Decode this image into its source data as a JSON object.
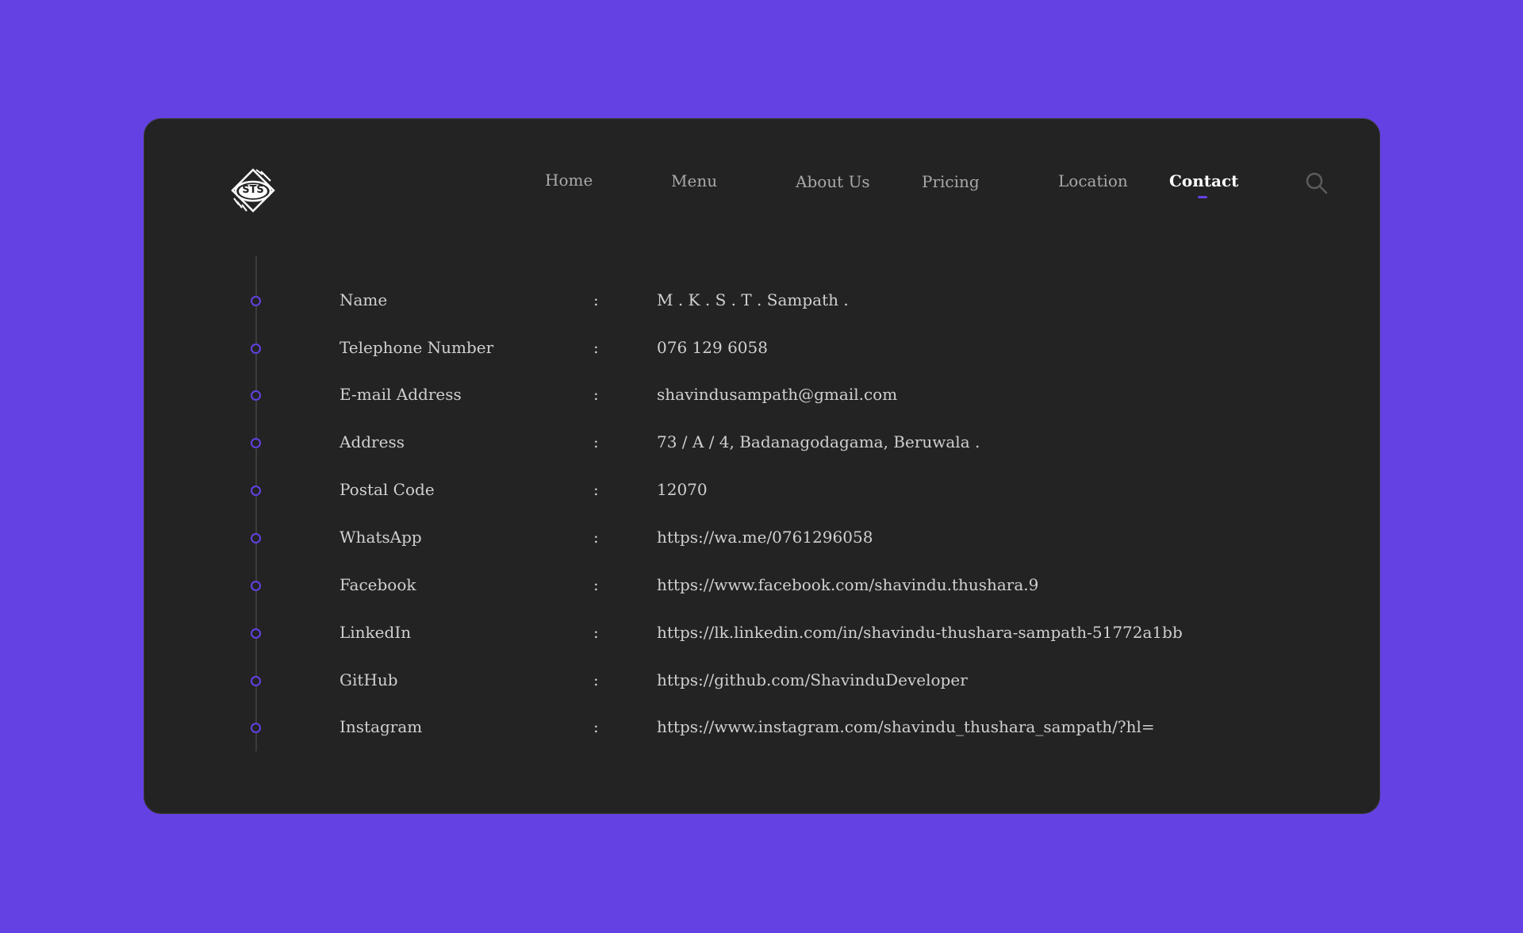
{
  "brand": {
    "logo_text": "STS",
    "logo_icon": "sts-badge-logo"
  },
  "nav": {
    "items": [
      {
        "label": "Home"
      },
      {
        "label": "Menu"
      },
      {
        "label": "About Us"
      },
      {
        "label": "Pricing"
      },
      {
        "label": "Location"
      },
      {
        "label": "Contact"
      }
    ],
    "active": "Contact",
    "search_icon": "search-icon"
  },
  "contact": {
    "rows": [
      {
        "label": "Name",
        "sep": ":",
        "value": "M . K . S . T . Sampath ."
      },
      {
        "label": "Telephone Number",
        "sep": ":",
        "value": "076 129 6058"
      },
      {
        "label": "E-mail Address",
        "sep": ":",
        "value": "shavindusampath@gmail.com"
      },
      {
        "label": "Address",
        "sep": ":",
        "value": "73 / A / 4, Badanagodagama, Beruwala ."
      },
      {
        "label": "Postal Code",
        "sep": ":",
        "value": "12070"
      },
      {
        "label": "WhatsApp",
        "sep": ":",
        "value": "https://wa.me/0761296058"
      },
      {
        "label": "Facebook",
        "sep": ":",
        "value": "https://www.facebook.com/shavindu.thushara.9"
      },
      {
        "label": "LinkedIn",
        "sep": ":",
        "value": "https://lk.linkedin.com/in/shavindu-thushara-sampath-51772a1bb"
      },
      {
        "label": "GitHub",
        "sep": ":",
        "value": "https://github.com/ShavinduDeveloper"
      },
      {
        "label": "Instagram",
        "sep": ":",
        "value": "https://www.instagram.com/shavindu_thushara_sampath/?hl="
      }
    ]
  },
  "colors": {
    "background": "#6441e3",
    "card": "#232323",
    "accent": "#6441e3",
    "text": "#d0d0d0",
    "nav_text": "#a9a9a9",
    "active_text": "#ffffff"
  }
}
